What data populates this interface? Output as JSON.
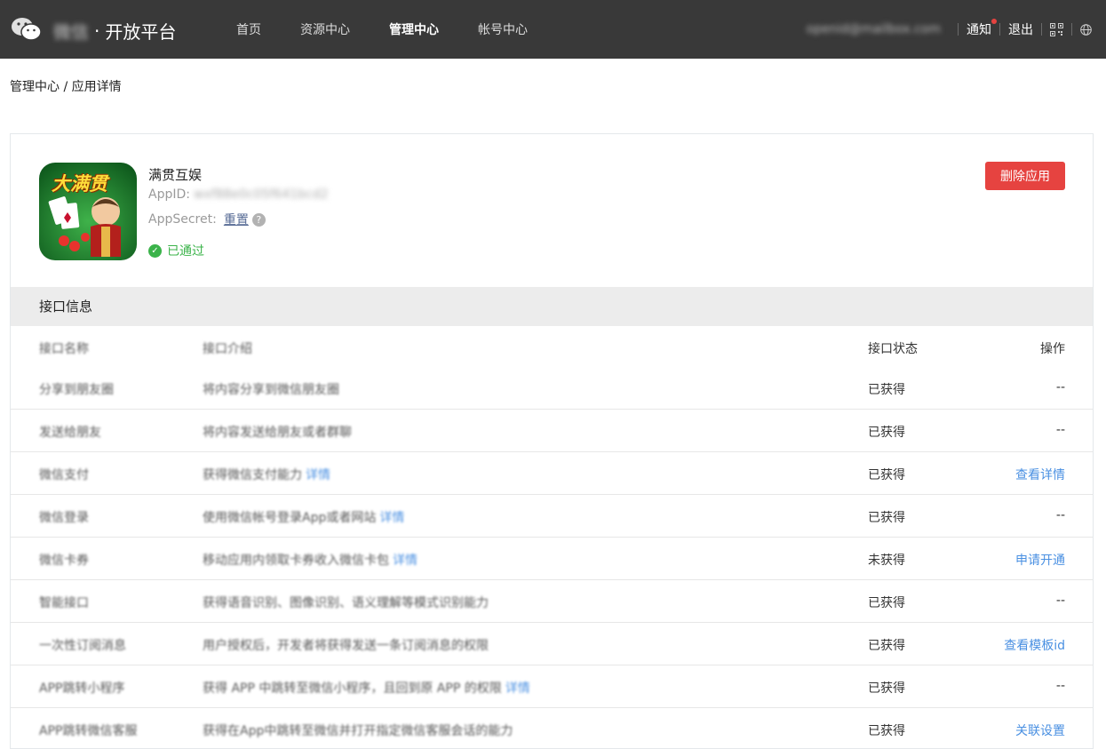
{
  "topbar": {
    "brand_blurred": "微信",
    "brand_dot": "·",
    "brand_title": "开放平台",
    "nav": [
      "首页",
      "资源中心",
      "管理中心",
      "帐号中心"
    ],
    "nav_active": 2,
    "email": "openid@mailbox.com",
    "notice": "通知",
    "logout": "退出",
    "icons": [
      "wechat-logo-icon",
      "qrcode-icon",
      "globe-icon"
    ]
  },
  "breadcrumb": "管理中心 / 应用详情",
  "app": {
    "name": "满贯互娱",
    "appid_label": "AppID:",
    "appid_value": "wxf88e0c05f641bcd2",
    "secret_label": "AppSecret:",
    "reset_link": "重置",
    "help": "?",
    "status": "已通过",
    "icon_text": "大满贯",
    "delete_button": "删除应用"
  },
  "section_title": "接口信息",
  "table": {
    "headers": [
      "接口名称",
      "接口介绍",
      "接口状态",
      "操作"
    ],
    "rows": [
      {
        "name": "分享到朋友圈",
        "desc": "将内容分享到微信朋友圈",
        "more": "",
        "status": "已获得",
        "action": "--",
        "action_link": false
      },
      {
        "name": "发送给朋友",
        "desc": "将内容发送给朋友或者群聊",
        "more": "",
        "status": "已获得",
        "action": "--",
        "action_link": false
      },
      {
        "name": "微信支付",
        "desc": "获得微信支付能力",
        "more": "详情",
        "status": "已获得",
        "action": "查看详情",
        "action_link": true
      },
      {
        "name": "微信登录",
        "desc": "使用微信帐号登录App或者网站",
        "more": "详情",
        "status": "已获得",
        "action": "--",
        "action_link": false
      },
      {
        "name": "微信卡券",
        "desc": "移动应用内领取卡券收入微信卡包",
        "more": "详情",
        "status": "未获得",
        "action": "申请开通",
        "action_link": true
      },
      {
        "name": "智能接口",
        "desc": "获得语音识别、图像识别、语义理解等模式识别能力",
        "more": "",
        "status": "已获得",
        "action": "--",
        "action_link": false
      },
      {
        "name": "一次性订阅消息",
        "desc": "用户授权后，开发者将获得发送一条订阅消息的权限",
        "more": "",
        "status": "已获得",
        "action": "查看模板id",
        "action_link": true
      },
      {
        "name": "APP跳转小程序",
        "desc": "获得 APP 中跳转至微信小程序，且回到原 APP 的权限",
        "more": "详情",
        "status": "已获得",
        "action": "--",
        "action_link": false
      },
      {
        "name": "APP跳转微信客服",
        "desc": "获得在App中跳转至微信并打开指定微信客服会话的能力",
        "more": "",
        "status": "已获得",
        "action": "关联设置",
        "action_link": true
      }
    ]
  },
  "colors": {
    "topbar": "#393939",
    "danger": "#e64340",
    "success": "#3bb34a",
    "link": "#4a90e2"
  }
}
